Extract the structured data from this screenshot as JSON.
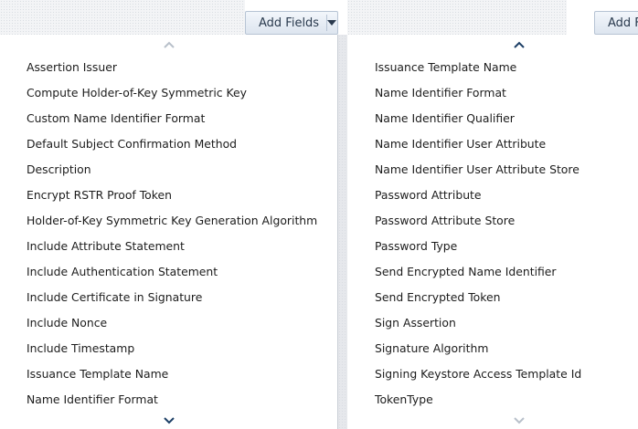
{
  "left_panel": {
    "button": {
      "label": "Add Fields",
      "caret_icon": "caret-down-icon"
    },
    "scroll_up_icon": "chevron-up-icon",
    "scroll_down_icon": "chevron-down-icon",
    "items": [
      {
        "label": "Assertion Issuer"
      },
      {
        "label": "Compute Holder-of-Key Symmetric Key"
      },
      {
        "label": "Custom Name Identifier Format"
      },
      {
        "label": "Default Subject Confirmation Method"
      },
      {
        "label": "Description"
      },
      {
        "label": "Encrypt RSTR Proof Token"
      },
      {
        "label": "Holder-of-Key Symmetric Key Generation Algorithm"
      },
      {
        "label": "Include Attribute Statement"
      },
      {
        "label": "Include Authentication Statement"
      },
      {
        "label": "Include Certificate in Signature"
      },
      {
        "label": "Include Nonce"
      },
      {
        "label": "Include Timestamp"
      },
      {
        "label": "Issuance Template Name"
      },
      {
        "label": "Name Identifier Format"
      }
    ]
  },
  "right_panel": {
    "button": {
      "label": "Add F"
    },
    "scroll_up_icon": "chevron-up-icon",
    "scroll_down_icon": "chevron-down-icon",
    "items": [
      {
        "label": "Issuance Template Name"
      },
      {
        "label": "Name Identifier Format"
      },
      {
        "label": "Name Identifier Qualifier"
      },
      {
        "label": "Name Identifier User Attribute"
      },
      {
        "label": "Name Identifier User Attribute Store"
      },
      {
        "label": "Password Attribute"
      },
      {
        "label": "Password Attribute Store"
      },
      {
        "label": "Password Type"
      },
      {
        "label": "Send Encrypted Name Identifier"
      },
      {
        "label": "Send Encrypted Token"
      },
      {
        "label": "Sign Assertion"
      },
      {
        "label": "Signature Algorithm"
      },
      {
        "label": "Signing Keystore Access Template Id"
      },
      {
        "label": "TokenType"
      }
    ]
  }
}
